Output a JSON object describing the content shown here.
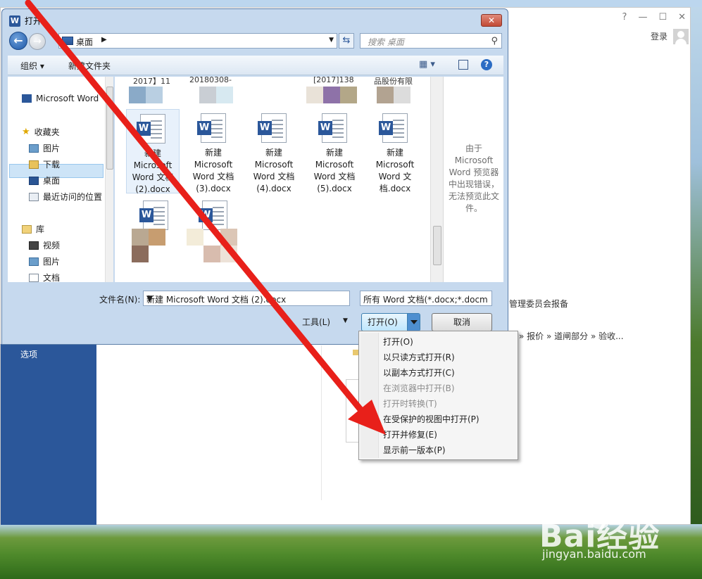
{
  "word": {
    "window_controls": [
      "?",
      "—",
      "☐",
      "✕"
    ],
    "login_label": "登录",
    "left_option": "选项",
    "text_line1": "管理委员会报备",
    "text_line2": "» 报价 » 道闸部分 » 验收..."
  },
  "dialog": {
    "title": "打开",
    "close": "✕",
    "address": "桌面",
    "search_placeholder": "搜索 桌面",
    "toolbar": {
      "organize": "组织 ▾",
      "new_folder": "新建文件夹",
      "view_icon": "▦ ▾",
      "help": "?"
    },
    "nav": {
      "recent_doc": "Microsoft Word",
      "favorites": "收藏夹",
      "pictures": "图片",
      "downloads": "下载",
      "desktop": "桌面",
      "recent_places": "最近访问的位置",
      "library": "库",
      "videos": "视频",
      "lib_pictures": "图片",
      "documents": "文档"
    },
    "top_clips": [
      "2017】11",
      "20180308-",
      "[2017]138",
      "品股份有限"
    ],
    "files": [
      {
        "name": "新建 Microsoft Word 文档 (2).docx"
      },
      {
        "name": "新建 Microsoft Word 文档 (3).docx"
      },
      {
        "name": "新建 Microsoft Word 文档 (4).docx"
      },
      {
        "name": "新建 Microsoft Word 文档 (5).docx"
      },
      {
        "name": "新建 Microsoft Word 文档.docx"
      }
    ],
    "preview_message": "由于 Microsoft Word 预览器中出现错误，无法预览此文件。",
    "filename_label": "文件名(N):",
    "filename_value": "新建 Microsoft Word 文档 (2).docx",
    "filetype_value": "所有 Word 文档(*.docx;*.docm",
    "tools_label": "工具(L)",
    "open_button": "打开(O)",
    "cancel_button": "取消"
  },
  "menu": {
    "items": [
      {
        "label": "打开(O)",
        "enabled": true
      },
      {
        "label": "以只读方式打开(R)",
        "enabled": true
      },
      {
        "label": "以副本方式打开(C)",
        "enabled": true
      },
      {
        "label": "在浏览器中打开(B)",
        "enabled": false
      },
      {
        "label": "打开时转换(T)",
        "enabled": false
      },
      {
        "label": "在受保护的视图中打开(P)",
        "enabled": true
      },
      {
        "label": "打开并修复(E)",
        "enabled": true
      },
      {
        "label": "显示前一版本(P)",
        "enabled": true
      }
    ]
  },
  "watermark": {
    "logo": "Bai经验",
    "url": "jingyan.baidu.com"
  },
  "colors": {
    "word_blue": "#2b579a",
    "arrow_red": "#e8201a"
  }
}
